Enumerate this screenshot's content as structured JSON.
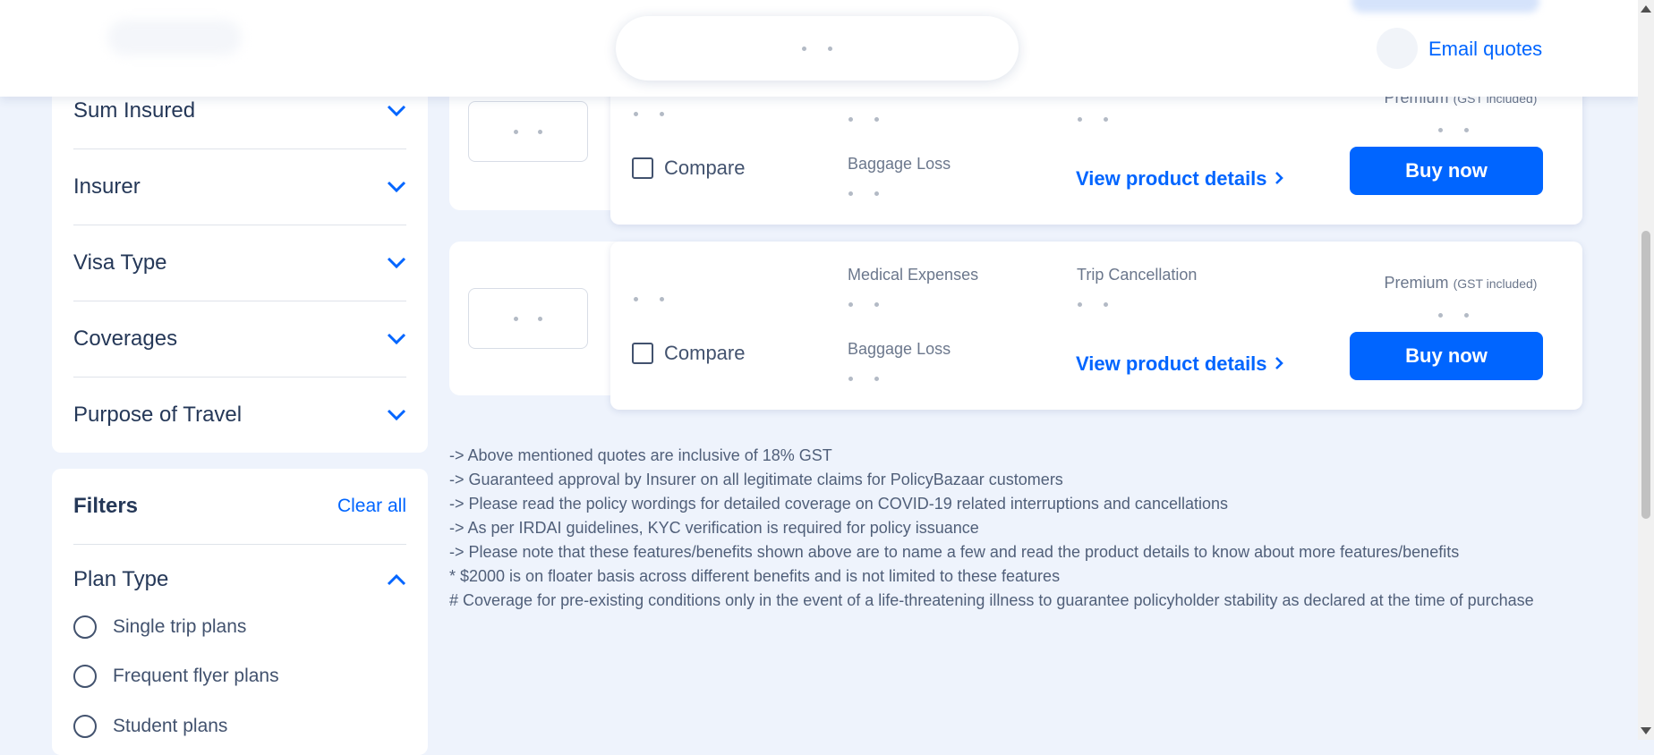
{
  "sidebar": {
    "accordion": [
      {
        "label": "Sum Insured"
      },
      {
        "label": "Insurer"
      },
      {
        "label": "Visa Type"
      },
      {
        "label": "Coverages"
      },
      {
        "label": "Purpose of Travel"
      }
    ],
    "filters": {
      "title": "Filters",
      "clear_all": "Clear all",
      "plan_type": {
        "label": "Plan Type",
        "options": [
          "Single trip plans",
          "Frequent flyer plans",
          "Student plans"
        ]
      }
    }
  },
  "quotes": [
    {
      "compare_label": "Compare",
      "features": [
        "Baggage Loss"
      ],
      "view_details": "View product details",
      "premium_label": "Premium",
      "premium_note": "(GST included)",
      "buy_label": "Buy now"
    },
    {
      "compare_label": "Compare",
      "features": [
        "Medical Expenses",
        "Trip Cancellation",
        "Baggage Loss"
      ],
      "view_details": "View product details",
      "premium_label": "Premium",
      "premium_note": "(GST included)",
      "buy_label": "Buy now"
    }
  ],
  "notes": [
    "-> Above mentioned quotes are inclusive of 18% GST",
    "-> Guaranteed approval by Insurer on all legitimate claims for PolicyBazaar customers",
    "-> Please read the policy wordings for detailed coverage on COVID-19 related interruptions and cancellations",
    "-> As per IRDAI guidelines, KYC verification is required for policy issuance",
    "-> Please note that these features/benefits shown above are to name a few and read the product details to know about more features/benefits",
    "* $2000 is on floater basis across different benefits and is not limited to these features",
    "# Coverage for pre-existing conditions only in the event of a life-threatening illness to guarantee policyholder stability as declared at the time of purchase"
  ],
  "header": {
    "email_quotes": "Email quotes"
  },
  "colors": {
    "accent": "#0065ff",
    "page_bg": "#eef3fc",
    "text_dark": "#253858",
    "text_muted": "#6b778c"
  }
}
